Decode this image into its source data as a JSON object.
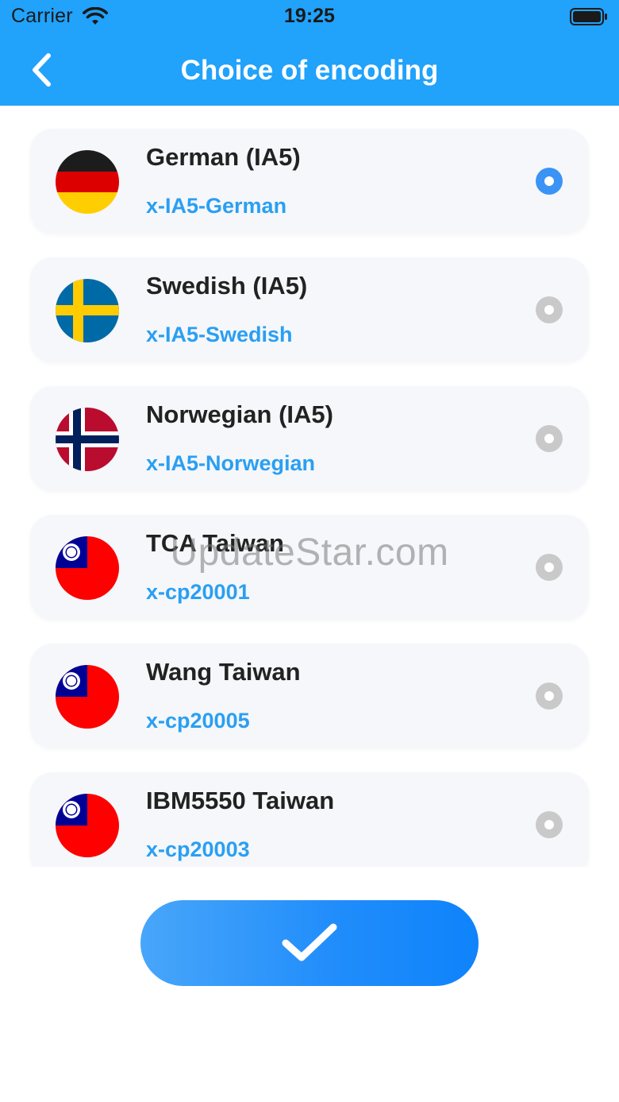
{
  "status_bar": {
    "carrier": "Carrier",
    "time": "19:25"
  },
  "nav": {
    "title": "Choice of encoding",
    "back_icon": "chevron-left-icon"
  },
  "colors": {
    "header": "#21a2fb",
    "selected_radio": "#3b93f5",
    "unselected_radio": "#c9c9c9",
    "code_text": "#2a9ff2"
  },
  "encodings": [
    {
      "name": "German (IA5)",
      "code": "x-IA5-German",
      "flag": "germany-flag-icon",
      "selected": true
    },
    {
      "name": "Swedish (IA5)",
      "code": "x-IA5-Swedish",
      "flag": "sweden-flag-icon",
      "selected": false
    },
    {
      "name": "Norwegian (IA5)",
      "code": "x-IA5-Norwegian",
      "flag": "norway-flag-icon",
      "selected": false
    },
    {
      "name": "TCA Taiwan",
      "code": "x-cp20001",
      "flag": "taiwan-flag-icon",
      "selected": false
    },
    {
      "name": "Wang Taiwan",
      "code": "x-cp20005",
      "flag": "taiwan-flag-icon",
      "selected": false
    },
    {
      "name": "IBM5550 Taiwan",
      "code": "x-cp20003",
      "flag": "taiwan-flag-icon",
      "selected": false
    }
  ],
  "confirm_icon": "checkmark-icon",
  "watermark": "UpdateStar.com"
}
